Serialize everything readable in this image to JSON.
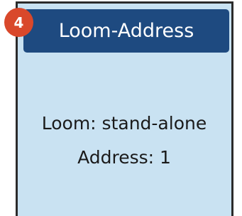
{
  "badge": {
    "step": "4"
  },
  "header": {
    "title": "Loom-Address"
  },
  "status": {
    "loom_line": "Loom: stand-alone",
    "address_line": "Address: 1"
  },
  "colors": {
    "panel_background": "#c9e2f2",
    "title_bar": "#1e4a80",
    "badge": "#d9482b",
    "frame_border": "#2b2b2b"
  }
}
